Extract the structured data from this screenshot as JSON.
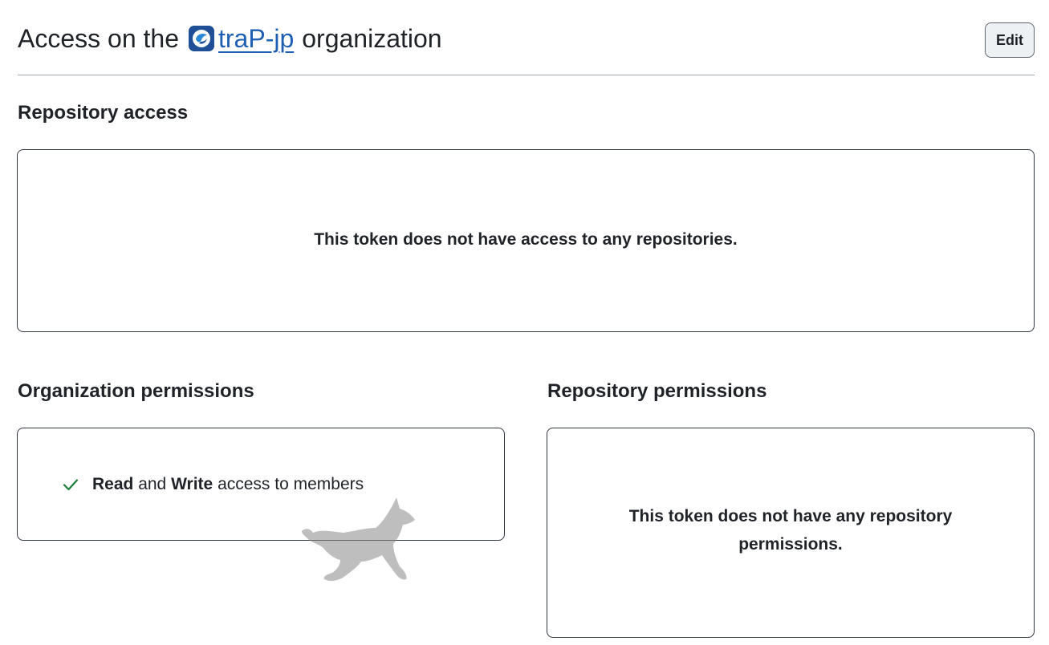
{
  "header": {
    "title_prefix": "Access on the",
    "org_name": "traP-jp",
    "title_suffix": "organization",
    "edit_label": "Edit"
  },
  "repository_access": {
    "title": "Repository access",
    "empty_message": "This token does not have access to any repositories."
  },
  "organization_permissions": {
    "title": "Organization permissions",
    "items": [
      {
        "level_read": "Read",
        "conj": "and",
        "level_write": "Write",
        "rest": "access to members"
      }
    ]
  },
  "repository_permissions": {
    "title": "Repository permissions",
    "empty_message_line1": "This token does not have any repository",
    "empty_message_line2": "permissions."
  },
  "colors": {
    "link": "#1f5fb3",
    "check": "#1a7f37",
    "border": "#30363d"
  },
  "icons": {
    "org_avatar": "org-avatar-icon",
    "check": "check-icon",
    "cat": "cat-silhouette"
  }
}
